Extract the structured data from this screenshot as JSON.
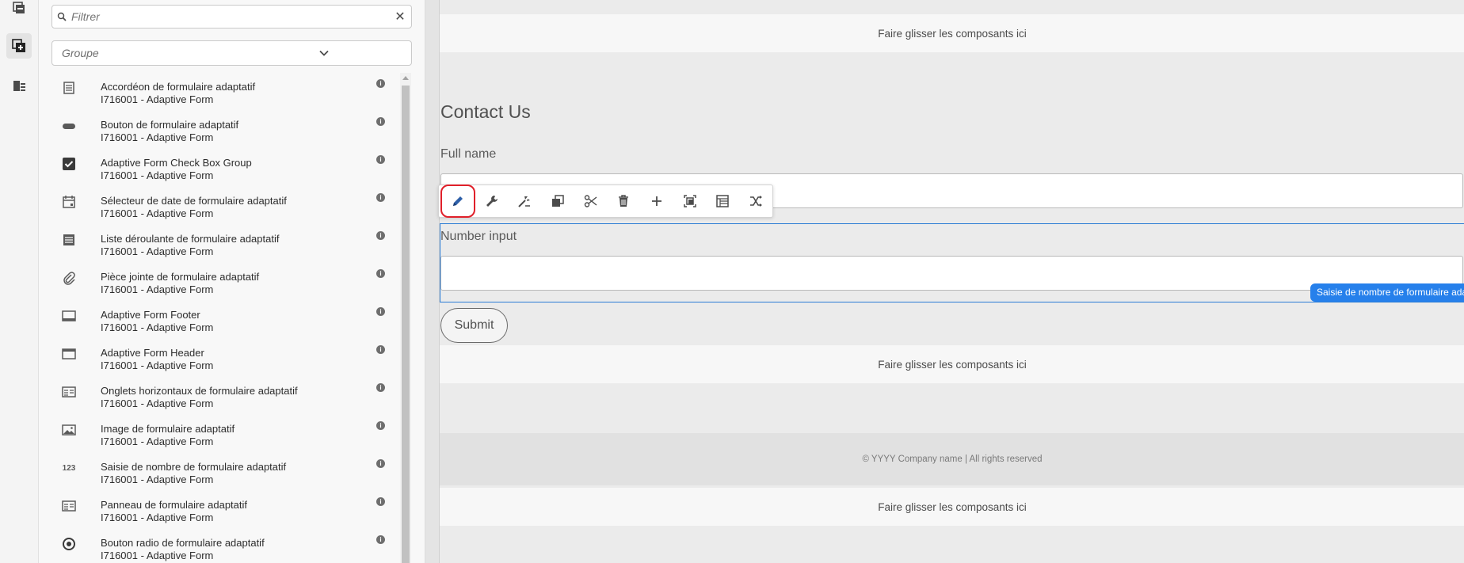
{
  "rail": {
    "icons": [
      "layers-icon",
      "components-icon",
      "content-tree-icon"
    ]
  },
  "panel": {
    "filter": {
      "placeholder": "Filtrer"
    },
    "group": {
      "label": "Groupe"
    },
    "items": [
      {
        "icon": "accordion-icon",
        "title": "Accordéon de formulaire adaptatif",
        "group": "I716001 - Adaptive Form"
      },
      {
        "icon": "button-icon",
        "title": "Bouton de formulaire adaptatif",
        "group": "I716001 - Adaptive Form"
      },
      {
        "icon": "checkbox-icon",
        "title": "Adaptive Form Check Box Group",
        "group": "I716001 - Adaptive Form"
      },
      {
        "icon": "calendar-icon",
        "title": "Sélecteur de date de formulaire adaptatif",
        "group": "I716001 - Adaptive Form"
      },
      {
        "icon": "dropdown-icon",
        "title": "Liste déroulante de formulaire adaptatif",
        "group": "I716001 - Adaptive Form"
      },
      {
        "icon": "paperclip-icon",
        "title": "Pièce jointe de formulaire adaptatif",
        "group": "I716001 - Adaptive Form"
      },
      {
        "icon": "footer-icon",
        "title": "Adaptive Form Footer",
        "group": "I716001 - Adaptive Form"
      },
      {
        "icon": "header-icon",
        "title": "Adaptive Form Header",
        "group": "I716001 - Adaptive Form"
      },
      {
        "icon": "tabs-icon",
        "title": "Onglets horizontaux de formulaire adaptatif",
        "group": "I716001 - Adaptive Form"
      },
      {
        "icon": "image-icon",
        "title": "Image de formulaire adaptatif",
        "group": "I716001 - Adaptive Form"
      },
      {
        "icon": "number-icon",
        "icon_text": "123",
        "title": "Saisie de nombre de formulaire adaptatif",
        "group": "I716001 - Adaptive Form"
      },
      {
        "icon": "panel-icon",
        "title": "Panneau de formulaire adaptatif",
        "group": "I716001 - Adaptive Form"
      },
      {
        "icon": "radio-icon",
        "title": "Bouton radio de formulaire adaptatif",
        "group": "I716001 - Adaptive Form"
      }
    ],
    "info_glyph": "i"
  },
  "canvas": {
    "dropzone_text": "Faire glisser les composants ici",
    "form_title": "Contact Us",
    "full_name_label": "Full name",
    "number_label": "Number input",
    "selected_badge": "Saisie de nombre de formulaire adaptatif",
    "submit_label": "Submit",
    "footer_text": "© YYYY Company name | All rights reserved"
  },
  "toolbar": [
    "edit-icon",
    "configure-icon",
    "style-icon",
    "copy-icon",
    "cut-icon",
    "delete-icon",
    "insert-icon",
    "group-icon",
    "parent-icon",
    "replace-icon"
  ],
  "colors": {
    "selection": "#2680eb",
    "highlight": "#e0202a"
  }
}
